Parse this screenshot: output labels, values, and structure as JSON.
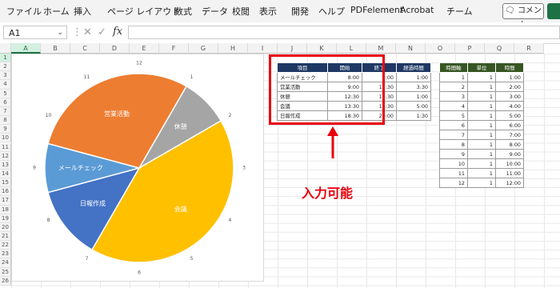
{
  "menu": [
    "ファイル",
    "ホーム",
    "挿入",
    "ページ レイアウト",
    "数式",
    "データ",
    "校閲",
    "表示",
    "開発",
    "ヘルプ",
    "PDFelement",
    "Acrobat",
    "チーム"
  ],
  "comment_label": "コメント",
  "namebox": "A1",
  "columns": [
    "A",
    "B",
    "C",
    "D",
    "E",
    "F",
    "G",
    "H",
    "I",
    "J",
    "K",
    "L",
    "M",
    "N",
    "O",
    "P",
    "Q",
    "R"
  ],
  "rows": [
    "1",
    "2",
    "3",
    "4",
    "5",
    "6",
    "7",
    "8",
    "9",
    "10",
    "11",
    "12",
    "13",
    "14",
    "15",
    "16",
    "17",
    "18",
    "19",
    "20",
    "21",
    "22",
    "23",
    "24",
    "25",
    "26"
  ],
  "schedule": {
    "headers": [
      "項目",
      "開始",
      "終了",
      "経過時間"
    ],
    "rows": [
      [
        "メールチェック",
        "8:00",
        "9:00",
        "1:00"
      ],
      [
        "営業活動",
        "9:00",
        "12:30",
        "3:30"
      ],
      [
        "休憩",
        "12:30",
        "13:30",
        "1:00"
      ],
      [
        "会議",
        "13:30",
        "18:30",
        "5:00"
      ],
      [
        "日報作成",
        "18:30",
        "20:00",
        "1:30"
      ]
    ]
  },
  "timeaxis": {
    "headers": [
      "時間軸",
      "単位",
      "時間"
    ],
    "rows": [
      [
        "1",
        "1",
        "1:00"
      ],
      [
        "2",
        "1",
        "2:00"
      ],
      [
        "3",
        "1",
        "3:00"
      ],
      [
        "4",
        "1",
        "4:00"
      ],
      [
        "5",
        "1",
        "5:00"
      ],
      [
        "6",
        "1",
        "6:00"
      ],
      [
        "7",
        "1",
        "7:00"
      ],
      [
        "8",
        "1",
        "8:00"
      ],
      [
        "9",
        "1",
        "9:00"
      ],
      [
        "10",
        "1",
        "10:00"
      ],
      [
        "11",
        "1",
        "11:00"
      ],
      [
        "12",
        "1",
        "12:00"
      ]
    ]
  },
  "annotation": "入力可能",
  "chart_data": {
    "type": "pie",
    "slices": [
      {
        "label": "休憩",
        "hours": 1,
        "color": "#a5a5a5"
      },
      {
        "label": "会議",
        "hours": 5,
        "color": "#ffc000"
      },
      {
        "label": "日報作成",
        "hours": 1.5,
        "color": "#4472c4"
      },
      {
        "label": "メールチェック",
        "hours": 1,
        "color": "#5b9bd5"
      },
      {
        "label": "営業活動",
        "hours": 3.5,
        "color": "#ed7d31"
      }
    ],
    "clock_labels": [
      "12",
      "1",
      "2",
      "3",
      "4",
      "5",
      "6",
      "7",
      "8",
      "9",
      "10",
      "11"
    ]
  }
}
